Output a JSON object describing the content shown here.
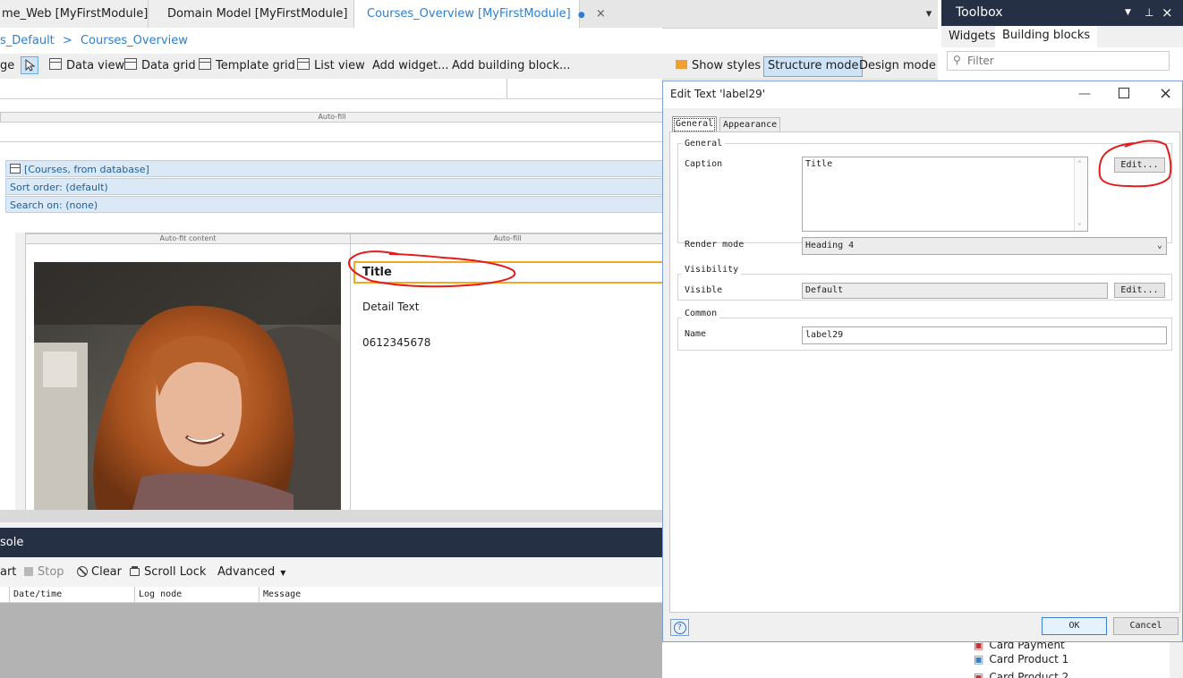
{
  "tabs": [
    {
      "label": "me_Web [MyFirstModule]",
      "active": false
    },
    {
      "label": "Domain Model [MyFirstModule]",
      "active": false
    },
    {
      "label": "Courses_Overview [MyFirstModule]",
      "active": true
    }
  ],
  "tab_close_glyph": "×",
  "tab_modified_glyph": "●",
  "tab_dropdown_glyph": "▾",
  "breadcrumb": {
    "items": [
      "s_Default",
      "Courses_Overview"
    ],
    "separator": ">"
  },
  "toolbar": {
    "partial_label": "ge",
    "items": [
      "Data view",
      "Data grid",
      "Template grid",
      "List view",
      "Add widget...",
      "Add building block..."
    ],
    "show_styles": "Show styles",
    "structure_mode": "Structure mode",
    "design_mode": "Design mode"
  },
  "canvas": {
    "auto_fill_top": "Auto-fill",
    "datasource": "[Courses, from database]",
    "sort_order": "Sort order: (default)",
    "search_on": "Search on: (none)",
    "col1_header": "Auto-fit content",
    "col2_header": "Auto-fill",
    "title_text": "Title",
    "detail_text": "Detail Text",
    "phone_text": "0612345678"
  },
  "console": {
    "title": "sole",
    "buttons": {
      "start": "art",
      "stop": "Stop",
      "clear": "Clear",
      "scroll_lock": "Scroll Lock",
      "advanced": "Advanced"
    },
    "columns": [
      "Date/time",
      "Log node",
      "Message"
    ]
  },
  "toolbox": {
    "title": "Toolbox",
    "tabs": [
      "Widgets",
      "Building blocks"
    ],
    "filter_placeholder": "Filter",
    "items": [
      "Card Payment",
      "Card Product 1",
      "Card Product 2"
    ]
  },
  "dialog": {
    "title": "Edit Text 'label29'",
    "tabs": [
      "General",
      "Appearance"
    ],
    "groups": {
      "general": "General",
      "visibility": "Visibility",
      "common": "Common"
    },
    "caption_label": "Caption",
    "caption_value": "Title",
    "edit_label": "Edit...",
    "render_mode_label": "Render mode",
    "render_mode_value": "Heading 4",
    "visible_label": "Visible",
    "visible_value": "Default",
    "name_label": "Name",
    "name_value": "label29",
    "ok_label": "OK",
    "cancel_label": "Cancel",
    "help_glyph": "?"
  },
  "colors": {
    "accent": "#2a7fd4",
    "dark_header": "#253044",
    "selection": "#f5a623",
    "annotation": "#e31b1b"
  }
}
